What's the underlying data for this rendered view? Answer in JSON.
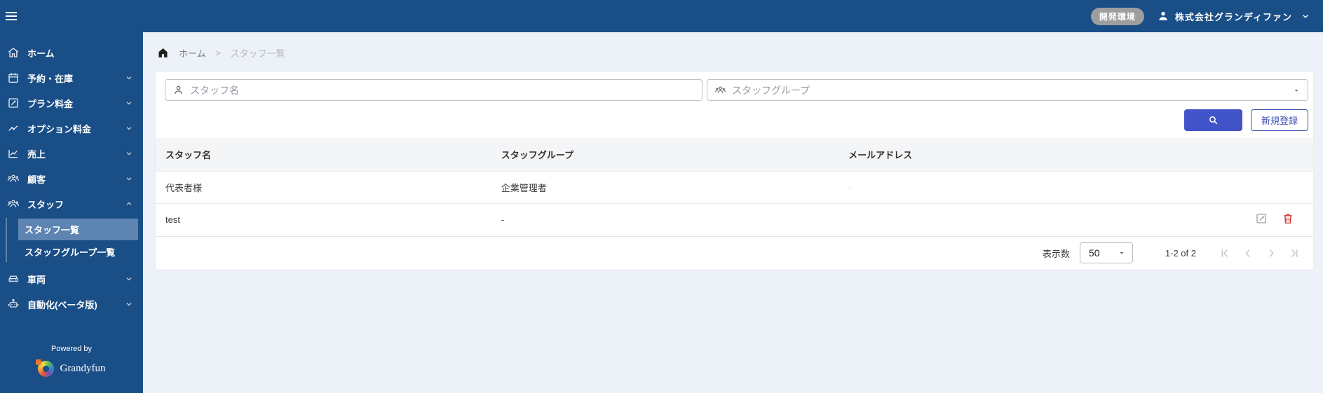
{
  "header": {
    "env_badge": "開発環境",
    "company": "株式会社グランディファン"
  },
  "sidebar": {
    "items": [
      {
        "label": "ホーム",
        "icon": "home-icon"
      },
      {
        "label": "予約・在庫",
        "icon": "calendar-icon"
      },
      {
        "label": "プラン料金",
        "icon": "edit-square-icon"
      },
      {
        "label": "オプション料金",
        "icon": "options-icon"
      },
      {
        "label": "売上",
        "icon": "chart-icon"
      },
      {
        "label": "顧客",
        "icon": "customers-icon"
      },
      {
        "label": "スタッフ",
        "icon": "staff-icon",
        "expanded": true
      },
      {
        "label": "車両",
        "icon": "car-icon"
      },
      {
        "label": "自動化(ベータ版)",
        "icon": "robot-icon"
      }
    ],
    "submenu": [
      {
        "label": "スタッフ一覧",
        "selected": true
      },
      {
        "label": "スタッフグループ一覧",
        "selected": false
      }
    ],
    "footer": {
      "powered_by": "Powered by",
      "brand": "Grandyfun"
    }
  },
  "breadcrumb": {
    "home": "ホーム",
    "separator": ">",
    "current": "スタッフ一覧"
  },
  "search": {
    "staff_name_placeholder": "スタッフ名",
    "staff_group_placeholder": "スタッフグループ",
    "register_label": "新規登録"
  },
  "table": {
    "columns": [
      "スタッフ名",
      "スタッフグループ",
      "メールアドレス"
    ],
    "rows": [
      {
        "name": "代表者様",
        "group": "企業管理者",
        "email": "-"
      },
      {
        "name": "test",
        "group": "-",
        "email": ""
      }
    ]
  },
  "pagination": {
    "per_page_label": "表示数",
    "per_page_value": "50",
    "range": "1-2 of 2"
  },
  "colors": {
    "sidebar_bg": "#1a4e87",
    "selected_item": "#5d84b2",
    "accent_button": "#4153c8",
    "outline_button": "#3f51b5",
    "badge": "#9e9e9e",
    "danger": "#d32f2f"
  }
}
